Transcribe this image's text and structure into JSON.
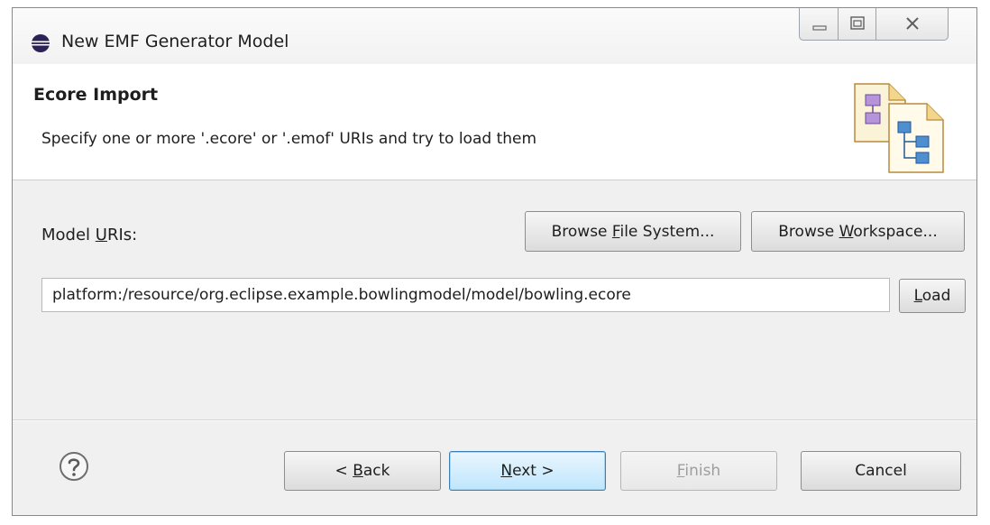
{
  "window": {
    "title": "New EMF Generator Model"
  },
  "header": {
    "title": "Ecore Import",
    "description": "Specify one or more '.ecore' or '.emof' URIs and try to load them"
  },
  "model_uris": {
    "label_prefix": "Model ",
    "label_mnemonic": "U",
    "label_suffix": "RIs:",
    "browse_fs_prefix": "Browse ",
    "browse_fs_mnemonic": "F",
    "browse_fs_suffix": "ile System...",
    "browse_ws_prefix": "Browse ",
    "browse_ws_mnemonic": "W",
    "browse_ws_suffix": "orkspace...",
    "uri_value": "platform:/resource/org.eclipse.example.bowlingmodel/model/bowling.ecore",
    "load_mnemonic": "L",
    "load_suffix": "oad"
  },
  "footer": {
    "back_prefix": "< ",
    "back_mnemonic": "B",
    "back_suffix": "ack",
    "next_mnemonic": "N",
    "next_suffix": "ext >",
    "finish_mnemonic": "F",
    "finish_suffix": "inish",
    "cancel_label": "Cancel"
  },
  "icons": {
    "app": "eclipse-icon",
    "help": "help-icon",
    "wizard": "ecore-import-wizard-icon"
  },
  "colors": {
    "primary_button_border": "#3c7fb1",
    "window_background": "#f0f0f0"
  }
}
